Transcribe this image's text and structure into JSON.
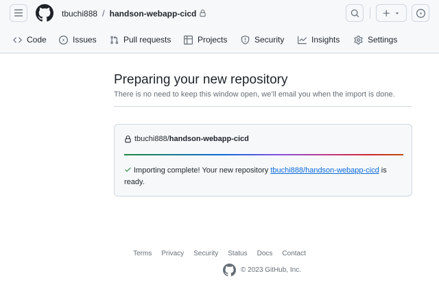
{
  "header": {
    "owner": "tbuchi888",
    "separator": "/",
    "repo": "handson-webapp-cicd"
  },
  "tabs": [
    {
      "label": "Code",
      "icon": "code-icon"
    },
    {
      "label": "Issues",
      "icon": "issue-opened-icon"
    },
    {
      "label": "Pull requests",
      "icon": "git-pull-request-icon"
    },
    {
      "label": "Projects",
      "icon": "table-icon"
    },
    {
      "label": "Security",
      "icon": "shield-icon"
    },
    {
      "label": "Insights",
      "icon": "graph-icon"
    },
    {
      "label": "Settings",
      "icon": "gear-icon"
    }
  ],
  "main": {
    "title": "Preparing your new repository",
    "subtitle": "There is no need to keep this window open, we’ll email you when the import is done.",
    "box": {
      "owner": "tbuchi888/",
      "repo": "handson-webapp-cicd",
      "progress": 1.0,
      "status_prefix": "Importing complete! Your new repository ",
      "status_link": "tbuchi888/handson-webapp-cicd",
      "status_suffix": " is ready."
    }
  },
  "footer": {
    "links": [
      "Terms",
      "Privacy",
      "Security",
      "Status",
      "Docs",
      "Contact"
    ],
    "copyright": "© 2023 GitHub, Inc."
  },
  "colors": {
    "accent": "#0969da",
    "success": "#1a7f37",
    "border": "#d0d7de"
  }
}
